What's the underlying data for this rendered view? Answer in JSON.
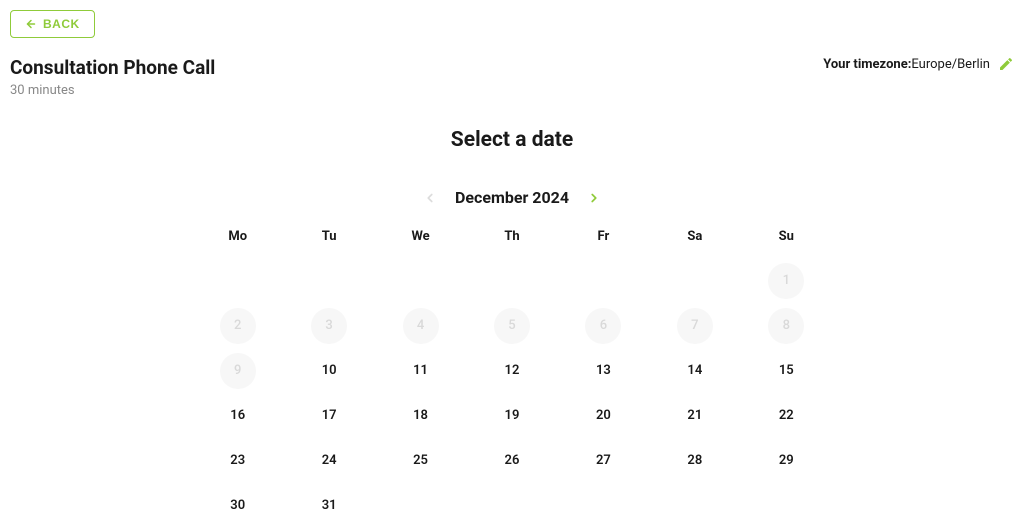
{
  "back": {
    "label": "BACK"
  },
  "header": {
    "title": "Consultation Phone Call",
    "duration": "30 minutes"
  },
  "timezone": {
    "label": "Your timezone:",
    "value": "Europe/Berlin"
  },
  "selectDate": {
    "title": "Select a date"
  },
  "month": {
    "label": "December 2024",
    "prev_enabled": false,
    "next_enabled": true
  },
  "daysOfWeek": [
    "Mo",
    "Tu",
    "We",
    "Th",
    "Fr",
    "Sa",
    "Su"
  ],
  "weeks": [
    [
      {
        "day": "",
        "state": "empty"
      },
      {
        "day": "",
        "state": "empty"
      },
      {
        "day": "",
        "state": "empty"
      },
      {
        "day": "",
        "state": "empty"
      },
      {
        "day": "",
        "state": "empty"
      },
      {
        "day": "",
        "state": "empty"
      },
      {
        "day": "1",
        "state": "disabled"
      }
    ],
    [
      {
        "day": "2",
        "state": "disabled"
      },
      {
        "day": "3",
        "state": "disabled"
      },
      {
        "day": "4",
        "state": "disabled"
      },
      {
        "day": "5",
        "state": "disabled"
      },
      {
        "day": "6",
        "state": "disabled"
      },
      {
        "day": "7",
        "state": "disabled"
      },
      {
        "day": "8",
        "state": "disabled"
      }
    ],
    [
      {
        "day": "9",
        "state": "disabled"
      },
      {
        "day": "10",
        "state": "available"
      },
      {
        "day": "11",
        "state": "available"
      },
      {
        "day": "12",
        "state": "available"
      },
      {
        "day": "13",
        "state": "available"
      },
      {
        "day": "14",
        "state": "available"
      },
      {
        "day": "15",
        "state": "available"
      }
    ],
    [
      {
        "day": "16",
        "state": "available"
      },
      {
        "day": "17",
        "state": "available"
      },
      {
        "day": "18",
        "state": "available"
      },
      {
        "day": "19",
        "state": "available"
      },
      {
        "day": "20",
        "state": "available"
      },
      {
        "day": "21",
        "state": "available"
      },
      {
        "day": "22",
        "state": "available"
      }
    ],
    [
      {
        "day": "23",
        "state": "available"
      },
      {
        "day": "24",
        "state": "available"
      },
      {
        "day": "25",
        "state": "available"
      },
      {
        "day": "26",
        "state": "available"
      },
      {
        "day": "27",
        "state": "available"
      },
      {
        "day": "28",
        "state": "available"
      },
      {
        "day": "29",
        "state": "available"
      }
    ],
    [
      {
        "day": "30",
        "state": "available"
      },
      {
        "day": "31",
        "state": "available"
      },
      {
        "day": "",
        "state": "empty"
      },
      {
        "day": "",
        "state": "empty"
      },
      {
        "day": "",
        "state": "empty"
      },
      {
        "day": "",
        "state": "empty"
      },
      {
        "day": "",
        "state": "empty"
      }
    ]
  ]
}
